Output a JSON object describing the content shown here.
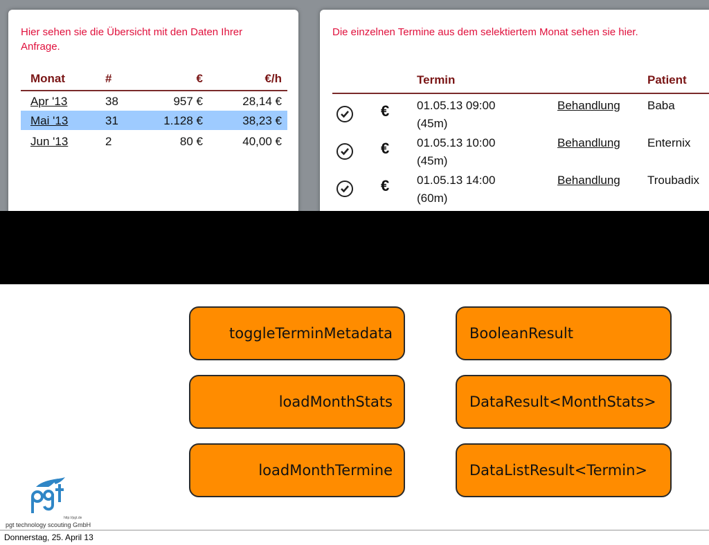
{
  "left_panel": {
    "intro": "Hier sehen sie die Übersicht mit den Daten Ihrer Anfrage.",
    "headers": [
      "Monat",
      "#",
      "€",
      "€/h"
    ],
    "rows": [
      {
        "month": "Apr '13",
        "count": "38",
        "amount": "957 €",
        "rate": "28,14 €"
      },
      {
        "month": "Mai '13",
        "count": "31",
        "amount": "1.128 €",
        "rate": "38,23 €"
      },
      {
        "month": "Jun '13",
        "count": "2",
        "amount": "80 €",
        "rate": "40,00 €"
      }
    ],
    "selected_row": 1
  },
  "right_panel": {
    "intro": "Die einzelnen Termine aus dem selektiertem Monat sehen sie hier.",
    "headers": {
      "termin": "Termin",
      "patient": "Patient"
    },
    "rows": [
      {
        "euro": "€",
        "date": "01.05.13 09:00",
        "duration": "(45m)",
        "link": "Behandlung",
        "patient": "Baba"
      },
      {
        "euro": "€",
        "date": "01.05.13 10:00",
        "duration": "(45m)",
        "link": "Behandlung",
        "patient": "Enternix"
      },
      {
        "euro": "€",
        "date": "01.05.13 14:00",
        "duration": "(60m)",
        "link": "Behandlung",
        "patient": "Troubadix"
      }
    ]
  },
  "methods": [
    {
      "name": "toggleTerminMetadata",
      "result": "BooleanResult"
    },
    {
      "name": "loadMonthStats",
      "result": "DataResult<MonthStats>"
    },
    {
      "name": "loadMonthTermine",
      "result": "DataListResult<Termin>"
    }
  ],
  "logo": {
    "brand": "pgt technology scouting GmbH",
    "url": "http://pgt.de"
  },
  "footer": {
    "date": "Donnerstag, 25. April 13"
  },
  "colors": {
    "accent_red": "#e0103c",
    "header_brown": "#7a1616",
    "selection_blue": "#9ecbff",
    "box_orange": "#ff8c00",
    "logo_blue": "#2f86c6"
  }
}
